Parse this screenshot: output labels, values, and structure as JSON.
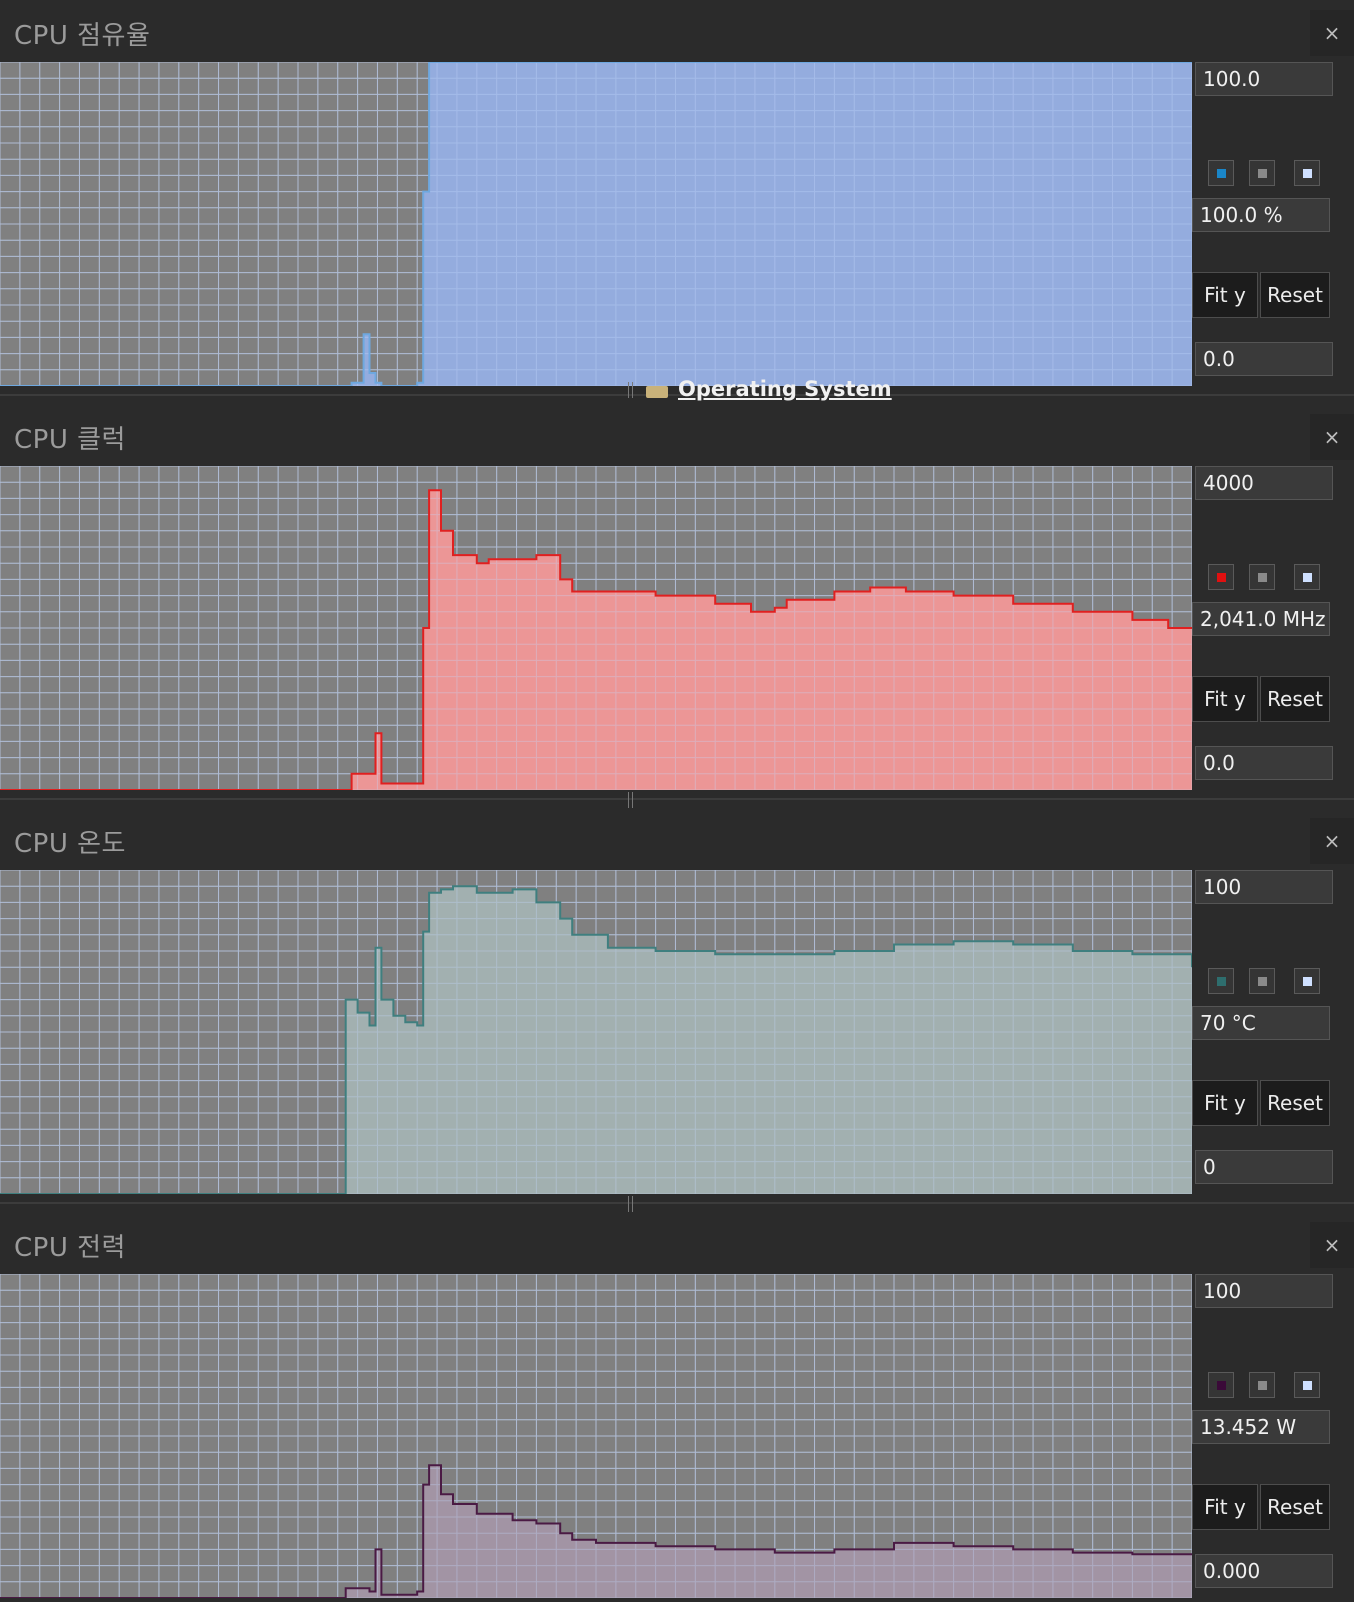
{
  "overlay": {
    "link_text": "Operating System"
  },
  "panels": [
    {
      "title": "CPU 점유율",
      "close_label": "×",
      "y_max": "100.0",
      "current": "100.0 %",
      "y_min": "0.0",
      "fit_label": "Fit y",
      "reset_label": "Reset",
      "colors": {
        "line": "#6ea8e0",
        "fill": "#98b4ee",
        "swatch": "#1a86c8"
      },
      "swatch_icons": [
        "line-color",
        "background-color",
        "grid-color"
      ]
    },
    {
      "title": "CPU 클럭",
      "close_label": "×",
      "y_max": "4000",
      "current": "2,041.0 MHz",
      "y_min": "0.0",
      "fit_label": "Fit y",
      "reset_label": "Reset",
      "colors": {
        "line": "#e02020",
        "fill": "#ff9a9a",
        "swatch": "#e01010"
      },
      "swatch_icons": [
        "line-color",
        "background-color",
        "grid-color"
      ]
    },
    {
      "title": "CPU 온도",
      "close_label": "×",
      "y_max": "100",
      "current": "70 °C",
      "y_min": "0",
      "fit_label": "Fit y",
      "reset_label": "Reset",
      "colors": {
        "line": "#3f7f7f",
        "fill": "#a8b8b8",
        "swatch": "#2e6e6e"
      },
      "swatch_icons": [
        "line-color",
        "background-color",
        "grid-color"
      ]
    },
    {
      "title": "CPU 전력",
      "close_label": "×",
      "y_max": "100",
      "current": "13.452 W",
      "y_min": "0.000",
      "fit_label": "Fit y",
      "reset_label": "Reset",
      "colors": {
        "line": "#4a1a44",
        "fill": "#a898aa",
        "swatch": "#3a0a38"
      },
      "swatch_icons": [
        "line-color",
        "background-color",
        "grid-color"
      ]
    }
  ],
  "chart_data": [
    {
      "type": "area",
      "y_unit": "%",
      "ylim": [
        0,
        100
      ],
      "grid": true,
      "x": [
        0,
        29,
        29.5,
        30.5,
        31,
        31.5,
        32,
        34,
        35,
        35.5,
        36,
        100
      ],
      "y": [
        0,
        0,
        1,
        16,
        4,
        1,
        0,
        0,
        1,
        60,
        100,
        100
      ]
    },
    {
      "type": "area",
      "y_unit": "MHz",
      "ylim": [
        0,
        4000
      ],
      "grid": true,
      "x": [
        0,
        29,
        29.5,
        31,
        31.5,
        32,
        35,
        35.5,
        36,
        37,
        38,
        40,
        41,
        43,
        45,
        47,
        48,
        50,
        55,
        60,
        63,
        65,
        66,
        70,
        73,
        76,
        80,
        85,
        90,
        95,
        98,
        100
      ],
      "y": [
        0,
        0,
        200,
        200,
        700,
        80,
        80,
        2000,
        3700,
        3200,
        2900,
        2800,
        2850,
        2850,
        2900,
        2600,
        2450,
        2450,
        2400,
        2300,
        2200,
        2250,
        2350,
        2450,
        2500,
        2450,
        2400,
        2300,
        2200,
        2100,
        2000,
        2000
      ]
    },
    {
      "type": "area",
      "y_unit": "°C",
      "ylim": [
        0,
        100
      ],
      "grid": true,
      "x": [
        0,
        28.9,
        29,
        30,
        31,
        31.5,
        32,
        33,
        34,
        35,
        35.5,
        36,
        37,
        38,
        40,
        43,
        45,
        47,
        48,
        51,
        55,
        60,
        65,
        70,
        75,
        80,
        85,
        90,
        95,
        100
      ],
      "y": [
        0,
        0,
        60,
        56,
        52,
        76,
        60,
        55,
        53,
        52,
        81,
        93,
        94,
        95,
        93,
        94,
        90,
        85,
        80,
        76,
        75,
        74,
        74,
        75,
        77,
        78,
        77,
        75,
        74,
        70
      ]
    },
    {
      "type": "area",
      "y_unit": "W",
      "ylim": [
        0,
        100
      ],
      "grid": true,
      "x": [
        0,
        28.9,
        29,
        31,
        31.5,
        32,
        35,
        35.5,
        36,
        37,
        38,
        40,
        43,
        45,
        47,
        48,
        50,
        55,
        60,
        65,
        70,
        75,
        80,
        85,
        90,
        95,
        100
      ],
      "y": [
        0,
        0,
        3,
        2,
        15,
        1,
        2,
        35,
        41,
        32,
        29,
        26,
        24,
        23,
        20,
        18,
        17,
        16,
        15,
        14,
        15,
        17,
        16,
        15,
        14,
        13.5,
        13.4
      ]
    }
  ]
}
